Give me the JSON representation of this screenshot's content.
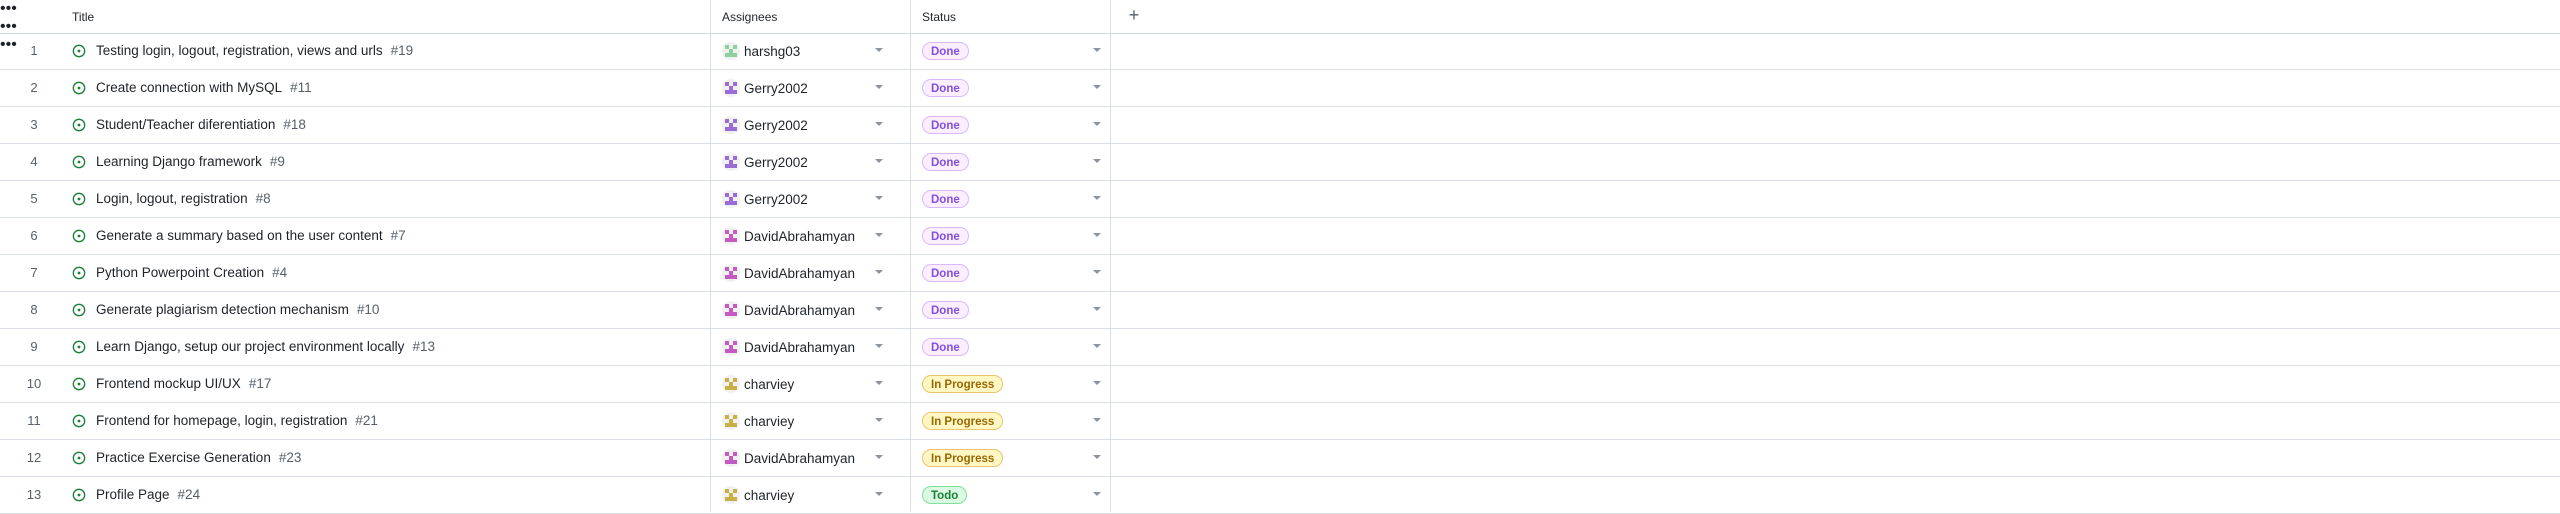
{
  "columns": {
    "title": "Title",
    "assignees": "Assignees",
    "status": "Status",
    "more_icon": "more-horizontal-icon",
    "add_icon": "plus-icon"
  },
  "status_styles": {
    "Done": {
      "bg": "#fbefff",
      "border": "#d8b9ff",
      "color": "#8250df"
    },
    "In Progress": {
      "bg": "#fff8c5",
      "border": "#e9c46a",
      "color": "#9a6700"
    },
    "Todo": {
      "bg": "#dafbe1",
      "border": "#82e09b",
      "color": "#1a7f37"
    }
  },
  "avatar_colors": {
    "harshg03": "#8fd19e",
    "Gerry2002": "#9b6bd6",
    "DavidAbrahamyan": "#c55bc0",
    "charviey": "#c9b046"
  },
  "rows": [
    {
      "num": "1",
      "title": "Testing login, logout, registration, views and urls",
      "issue": "#19",
      "assignee": "harshg03",
      "status": "Done"
    },
    {
      "num": "2",
      "title": "Create connection with MySQL",
      "issue": "#11",
      "assignee": "Gerry2002",
      "status": "Done"
    },
    {
      "num": "3",
      "title": "Student/Teacher diferentiation",
      "issue": "#18",
      "assignee": "Gerry2002",
      "status": "Done"
    },
    {
      "num": "4",
      "title": "Learning Django framework",
      "issue": "#9",
      "assignee": "Gerry2002",
      "status": "Done"
    },
    {
      "num": "5",
      "title": "Login, logout, registration",
      "issue": "#8",
      "assignee": "Gerry2002",
      "status": "Done"
    },
    {
      "num": "6",
      "title": "Generate a summary based on the user content",
      "issue": "#7",
      "assignee": "DavidAbrahamyan",
      "status": "Done"
    },
    {
      "num": "7",
      "title": "Python Powerpoint Creation",
      "issue": "#4",
      "assignee": "DavidAbrahamyan",
      "status": "Done"
    },
    {
      "num": "8",
      "title": "Generate plagiarism detection mechanism",
      "issue": "#10",
      "assignee": "DavidAbrahamyan",
      "status": "Done"
    },
    {
      "num": "9",
      "title": "Learn Django, setup our project environment locally",
      "issue": "#13",
      "assignee": "DavidAbrahamyan",
      "status": "Done"
    },
    {
      "num": "10",
      "title": "Frontend mockup UI/UX",
      "issue": "#17",
      "assignee": "charviey",
      "status": "In Progress"
    },
    {
      "num": "11",
      "title": "Frontend for homepage, login, registration",
      "issue": "#21",
      "assignee": "charviey",
      "status": "In Progress"
    },
    {
      "num": "12",
      "title": "Practice Exercise Generation",
      "issue": "#23",
      "assignee": "DavidAbrahamyan",
      "status": "In Progress"
    },
    {
      "num": "13",
      "title": "Profile Page",
      "issue": "#24",
      "assignee": "charviey",
      "status": "Todo"
    }
  ]
}
